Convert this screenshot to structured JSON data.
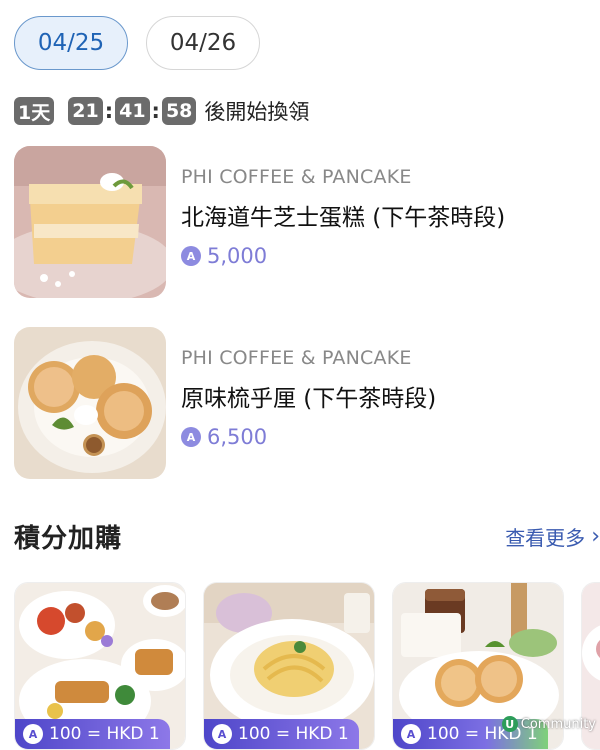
{
  "date_tabs": [
    {
      "label": "04/25",
      "active": true
    },
    {
      "label": "04/26",
      "active": false
    }
  ],
  "countdown": {
    "days": "1天",
    "hours": "21",
    "minutes": "41",
    "seconds": "58",
    "suffix": "後開始換領"
  },
  "rewards": [
    {
      "brand": "PHI COFFEE & PANCAKE",
      "name": "北海道牛芝士蛋糕 (下午茶時段)",
      "points": "5,000",
      "image": "cake-slice"
    },
    {
      "brand": "PHI COFFEE & PANCAKE",
      "name": "原味梳乎厘 (下午茶時段)",
      "points": "6,500",
      "image": "souffle-pancakes"
    }
  ],
  "section": {
    "title": "積分加購",
    "see_more": "查看更多"
  },
  "cards": [
    {
      "badge": "100 = HKD 1",
      "image": "breakfast-platter"
    },
    {
      "badge": "100 = HKD 1",
      "image": "carbonara-pasta"
    },
    {
      "badge": "100 = HKD 1",
      "image": "pancakes-coffee"
    }
  ],
  "watermark": "Community",
  "colors": {
    "accent_blue": "#1f63b5",
    "points_purple": "#7e7cd6",
    "badge_gradient_start": "#4e46c9",
    "badge_gradient_end": "#8d78e8"
  },
  "icons": {
    "points": "points-icon",
    "chevron": "chevron-right-icon"
  }
}
